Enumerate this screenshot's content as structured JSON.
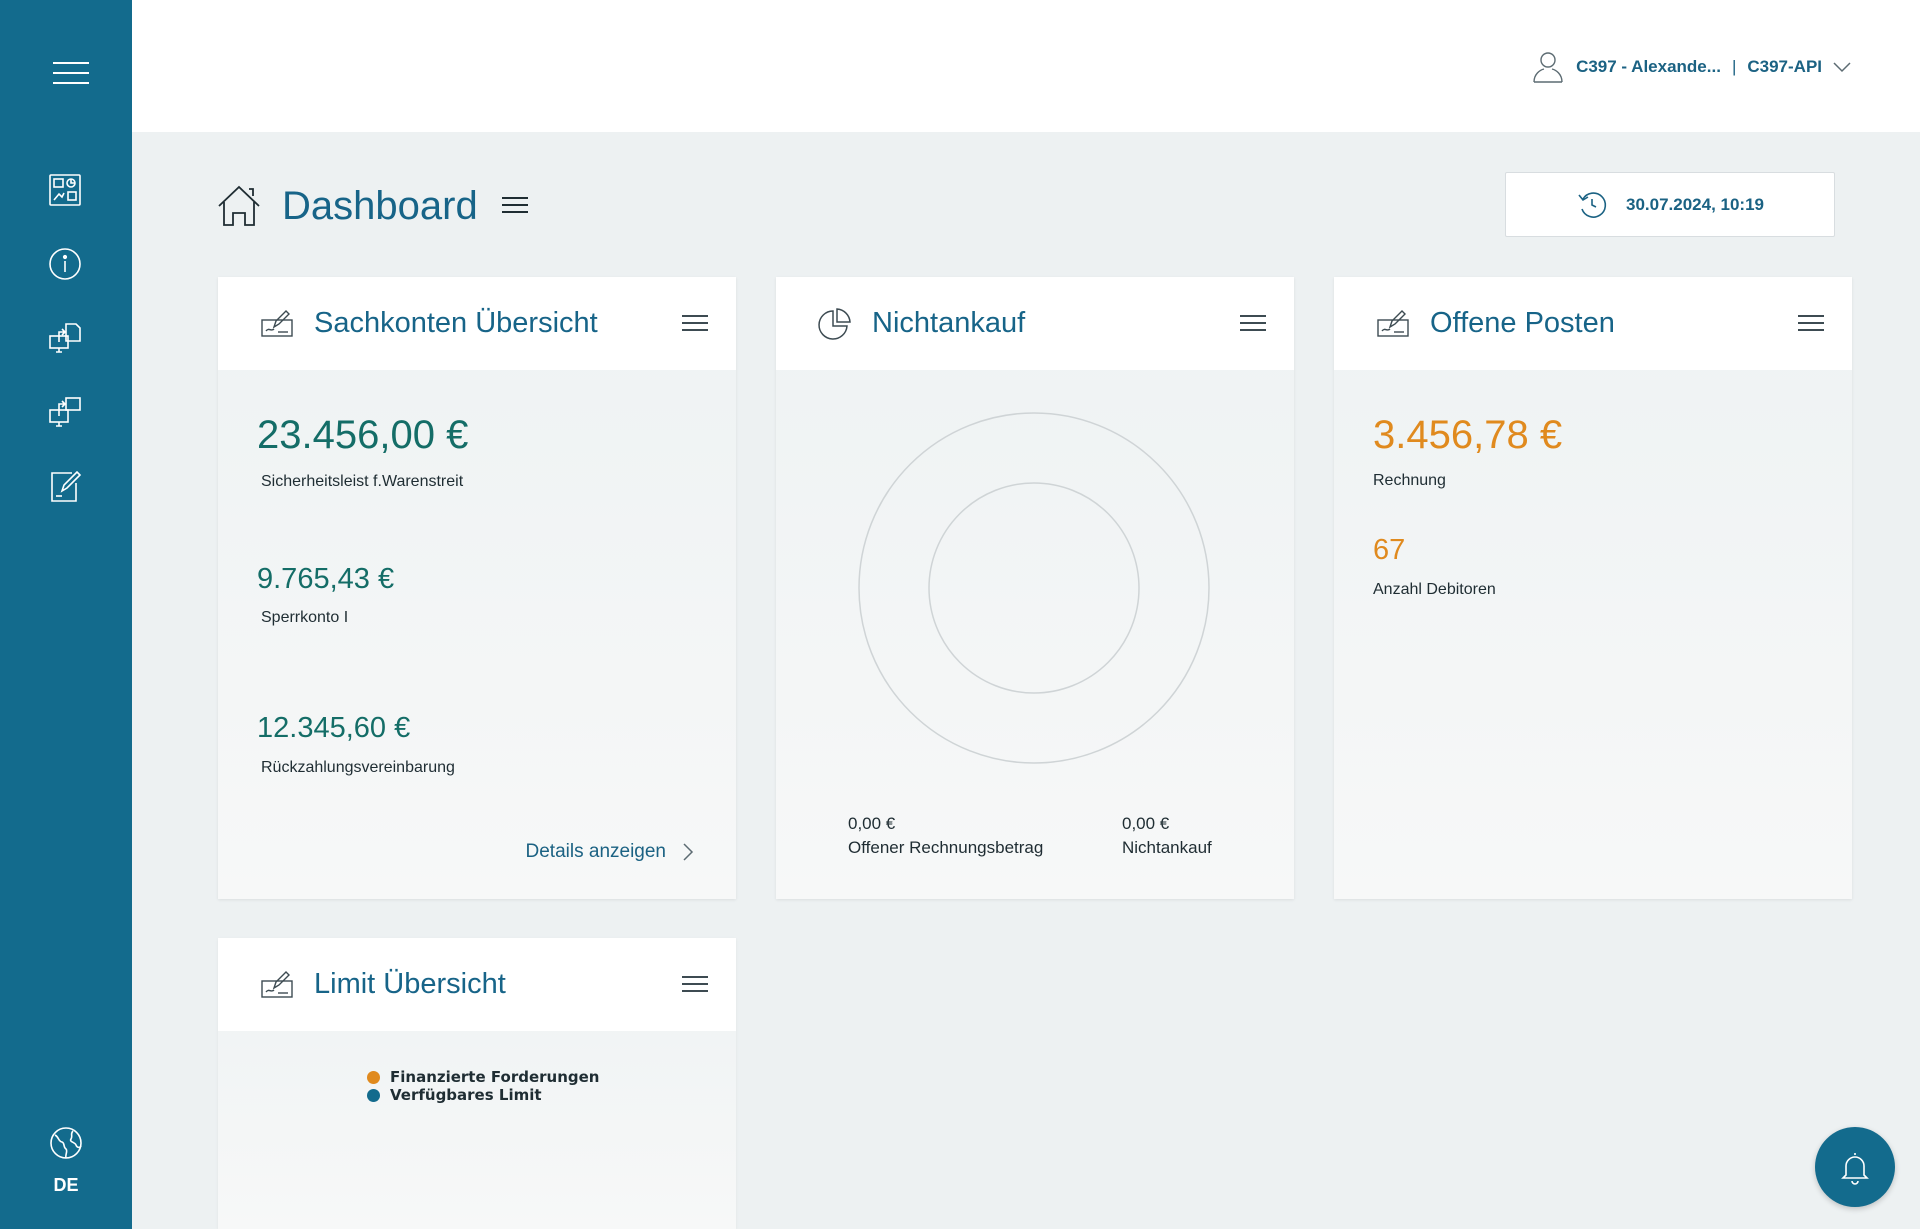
{
  "header": {
    "user_name": "C397 - Alexande...",
    "separator": "|",
    "account": "C397-API"
  },
  "sidebar": {
    "items": [
      {
        "icon": "dashboard-icon"
      },
      {
        "icon": "info-icon"
      },
      {
        "icon": "upload-monitor-icon"
      },
      {
        "icon": "transfer-monitor-icon"
      },
      {
        "icon": "edit-document-icon"
      }
    ],
    "language": "DE"
  },
  "page": {
    "title": "Dashboard",
    "refresh_timestamp": "30.07.2024, 10:19"
  },
  "cards": {
    "sachkonten": {
      "title": "Sachkonten Übersicht",
      "entries": [
        {
          "amount": "23.456,00 €",
          "label": "Sicherheitsleist f.Warenstreit"
        },
        {
          "amount": "9.765,43 €",
          "label": "Sperrkonto I"
        },
        {
          "amount": "12.345,60 €",
          "label": "Rückzahlungsvereinbarung"
        }
      ],
      "details_link": "Details anzeigen"
    },
    "nichtankauf": {
      "title": "Nichtankauf",
      "legend": [
        {
          "value": "0,00 €",
          "label": "Offener Rechnungsbetrag"
        },
        {
          "value": "0,00 €",
          "label": "Nichtankauf"
        }
      ]
    },
    "offene_posten": {
      "title": "Offene Posten",
      "amount": "3.456,78 €",
      "amount_label": "Rechnung",
      "count": "67",
      "count_label": "Anzahl Debitoren"
    },
    "limit": {
      "title": "Limit Übersicht",
      "legend": [
        {
          "label": "Finanzierte Forderungen",
          "color": "#e08a1e"
        },
        {
          "label": "Verfügbares Limit",
          "color": "#136b8d"
        }
      ]
    }
  },
  "colors": {
    "sidebar": "#136b8d",
    "accent_teal": "#146d67",
    "accent_orange": "#e08a1e",
    "title_blue": "#176488"
  }
}
